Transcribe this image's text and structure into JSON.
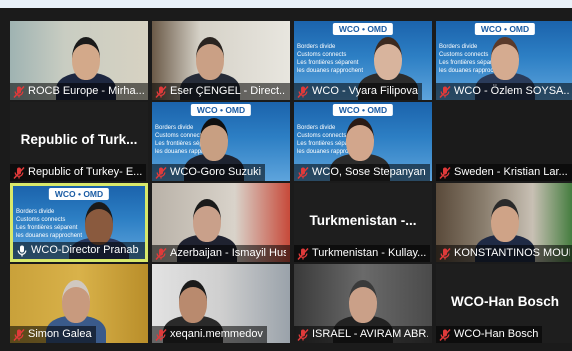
{
  "app": {
    "title": ""
  },
  "banner": {
    "logo": "WCO • OMD",
    "lines": [
      "Borders divide",
      "Customs connects",
      "Les frontières séparent",
      "les douanes rapprochent"
    ]
  },
  "participants": [
    {
      "label": "ROCB Europe - Mirha...",
      "muted": true,
      "active": false
    },
    {
      "label": "Eser ÇENGEL - Direct...",
      "muted": true,
      "active": false
    },
    {
      "label": "WCO - Vyara Filipova",
      "muted": true,
      "active": false
    },
    {
      "label": "WCO - Özlem SOYSA...",
      "muted": true,
      "active": false
    },
    {
      "label": "Republic of Turkey- E...",
      "muted": true,
      "active": false,
      "video_off_text": "Republic of Turk..."
    },
    {
      "label": "WCO-Goro Suzuki",
      "muted": true,
      "active": false
    },
    {
      "label": "WCO, Sose Stepanyan",
      "muted": true,
      "active": false
    },
    {
      "label": "Sweden - Kristian Lar...",
      "muted": true,
      "active": false
    },
    {
      "label": "WCO-Director Pranab Das",
      "muted": false,
      "active": true
    },
    {
      "label": "Azerbaijan - Ismayil Hus...",
      "muted": true,
      "active": false
    },
    {
      "label": "Turkmenistan - Kullay...",
      "muted": true,
      "active": false,
      "video_off_text": "Turkmenistan -..."
    },
    {
      "label": "KONSTANTINOS MOURT...",
      "muted": true,
      "active": false
    },
    {
      "label": "Simon Galea",
      "muted": true,
      "active": false
    },
    {
      "label": "xeqani.memmedov",
      "muted": true,
      "active": false
    },
    {
      "label": "ISRAEL - AVIRAM ABR...",
      "muted": true,
      "active": false
    },
    {
      "label": "WCO-Han Bosch",
      "muted": true,
      "active": false,
      "video_off_text": "WCO-Han Bosch"
    }
  ],
  "colors": {
    "muted_icon": "#e03a3a",
    "active_border": "#d8e86a",
    "wco_blue": "#1b63ac"
  }
}
